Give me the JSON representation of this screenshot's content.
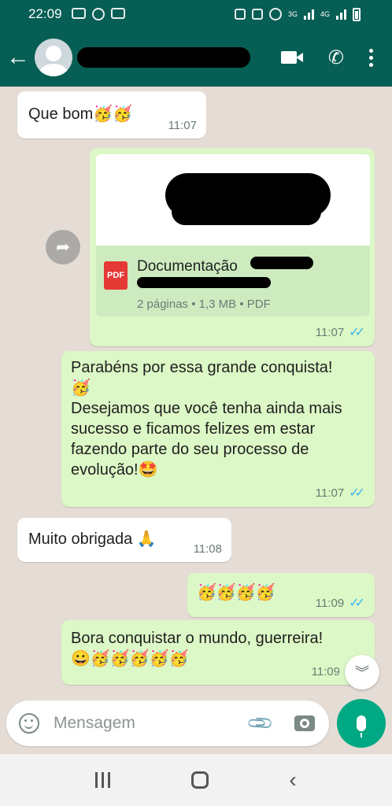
{
  "status_bar": {
    "time": "22:09",
    "net_left": "3G",
    "net_right": "4G"
  },
  "header": {
    "back_label": "←",
    "phone_glyph": "✆"
  },
  "messages": [
    {
      "id": "m1",
      "dir": "in",
      "text": "Que bom",
      "emoji": "🥳🥳",
      "time": "11:07"
    },
    {
      "id": "m2",
      "dir": "out",
      "type": "document",
      "file_name": "Documentação",
      "file_ext_label": "PDF",
      "file_info": "2 páginas • 1,3 MB • PDF",
      "time": "11:07",
      "status": "read"
    },
    {
      "id": "m3",
      "dir": "out",
      "text_line1": "Parabéns por essa grande conquista!",
      "emoji1": "🥳",
      "text_line2": "Desejamos que você tenha ainda mais sucesso e ficamos felizes em estar fazendo parte do seu processo de evolução!",
      "emoji2": "🤩",
      "time": "11:07",
      "status": "read"
    },
    {
      "id": "m4",
      "dir": "in",
      "text": "Muito obrigada",
      "emoji": "🙏",
      "time": "11:08"
    },
    {
      "id": "m5",
      "dir": "out",
      "emoji": "🥳🥳🥳🥳",
      "time": "11:09",
      "status": "read"
    },
    {
      "id": "m6",
      "dir": "out",
      "text": "Bora conquistar o mundo, guerreira!",
      "emoji": "😀🥳🥳🥳🥳🥳",
      "time": "11:09"
    }
  ],
  "ticks": "✓✓",
  "forward_glyph": "➦",
  "scroll_down_glyph": "︾",
  "composer": {
    "placeholder": "Mensagem",
    "clip_glyph": "📎"
  },
  "nav": {
    "back_glyph": "‹"
  },
  "colors": {
    "header": "#075e54",
    "outgoing": "#dcf8c6",
    "incoming": "#ffffff",
    "accent": "#00a884",
    "read_tick": "#34b7f1"
  }
}
